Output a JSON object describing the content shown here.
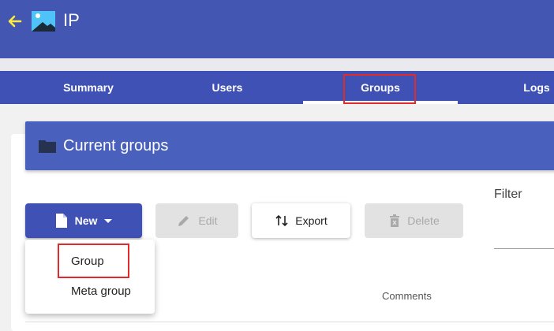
{
  "header": {
    "title": "IP"
  },
  "tabs": [
    {
      "label": "Summary"
    },
    {
      "label": "Users"
    },
    {
      "label": "Groups"
    },
    {
      "label": "Logs"
    }
  ],
  "section": {
    "title": "Current groups"
  },
  "toolbar": {
    "new_label": "New",
    "edit_label": "Edit",
    "export_label": "Export",
    "delete_label": "Delete"
  },
  "filter": {
    "label": "Filter"
  },
  "new_menu": {
    "items": [
      {
        "label": "Group"
      },
      {
        "label": "Meta group"
      }
    ]
  },
  "table": {
    "columns": [
      "Comments"
    ]
  },
  "colors": {
    "primary": "#3f51b5",
    "highlight": "#e12a2a",
    "back_arrow": "#ffeb3b"
  }
}
